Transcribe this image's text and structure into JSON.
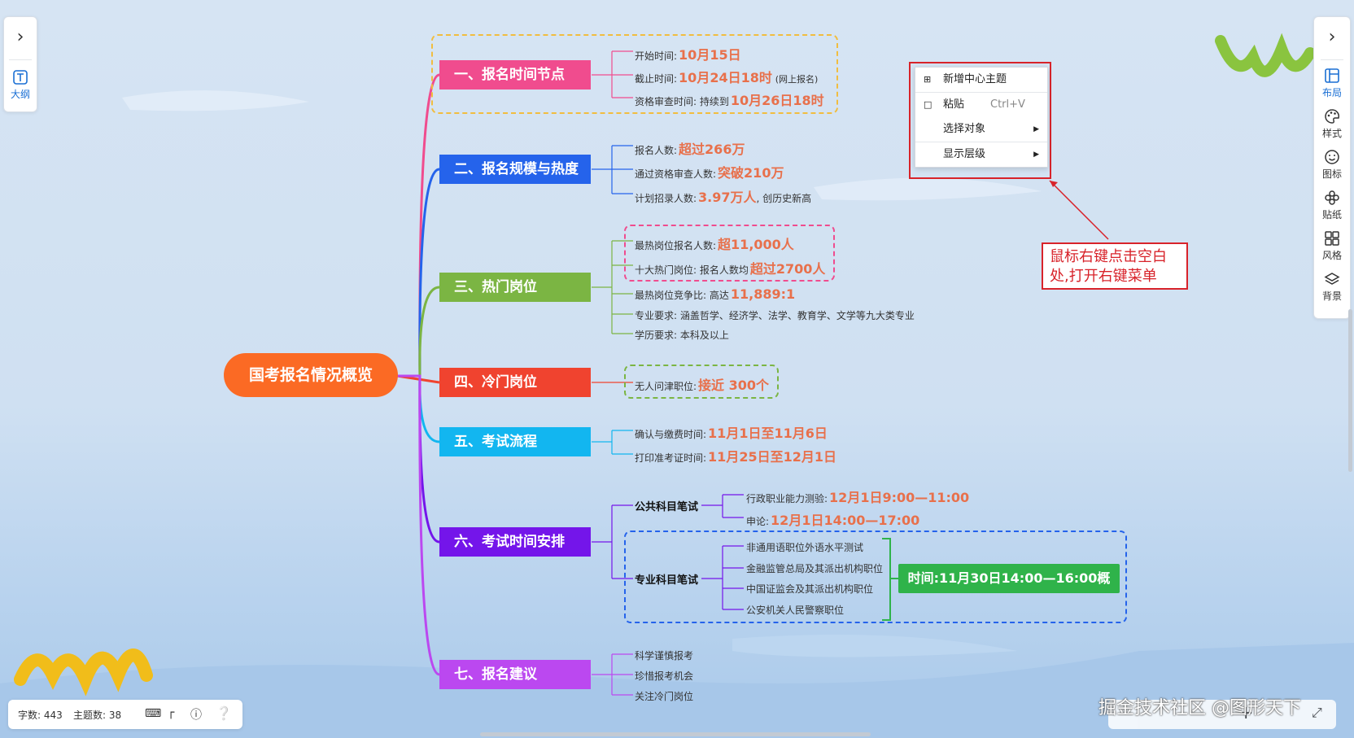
{
  "left_panel": {
    "expand_icon": "chevron-right-icon",
    "outline_label": "大纲"
  },
  "right_panel": {
    "tools": [
      {
        "icon": "layout-icon",
        "label": "布局",
        "active": true
      },
      {
        "icon": "palette-icon",
        "label": "样式",
        "active": false
      },
      {
        "icon": "emoji-icon",
        "label": "图标",
        "active": false
      },
      {
        "icon": "sticker-icon",
        "label": "贴纸",
        "active": false
      },
      {
        "icon": "grid-icon",
        "label": "风格",
        "active": false
      },
      {
        "icon": "layers-icon",
        "label": "背景",
        "active": false
      }
    ]
  },
  "mindmap": {
    "root": "国考报名情况概览",
    "branches": [
      {
        "label": "一、报名时间节点",
        "color": "#f04c8e"
      },
      {
        "label": "二、报名规模与热度",
        "color": "#2563eb"
      },
      {
        "label": "三、热门岗位",
        "color": "#7bb543"
      },
      {
        "label": "四、冷门岗位",
        "color": "#f0432f"
      },
      {
        "label": "五、考试流程",
        "color": "#12b6f0"
      },
      {
        "label": "六、考试时间安排",
        "color": "#7415ea"
      },
      {
        "label": "七、报名建议",
        "color": "#bb48f0"
      }
    ],
    "b1": {
      "l1": {
        "text": "开始时间:",
        "hi": "10月15日"
      },
      "l2": {
        "text": "截止时间:",
        "hi": "10月24日18时",
        "tail": "(网上报名)"
      },
      "l3": {
        "text": "资格审查时间:  持续到",
        "hi": "10月26日18时"
      }
    },
    "b2": {
      "l1": {
        "text": "报名人数:",
        "hi": "超过266万"
      },
      "l2": {
        "text": "通过资格审查人数:",
        "hi": "突破210万"
      },
      "l3": {
        "text": "计划招录人数:",
        "hi": "3.97万人",
        "tail": ", 创历史新高"
      }
    },
    "b3": {
      "l1": {
        "text": "最热岗位报名人数:",
        "hi": "超11,000人"
      },
      "l2": {
        "text": "十大热门岗位:  报名人数均",
        "hi": "超过2700人"
      },
      "l3": {
        "text": "最热岗位竞争比:  高达",
        "hi": "11,889:1"
      },
      "l4": {
        "text": "专业要求:  涵盖哲学、经济学、法学、教育学、文学等九大类专业"
      },
      "l5": {
        "text": "学历要求:  本科及以上"
      }
    },
    "b4": {
      "l1": {
        "text": "无人问津职位:",
        "hi": "接近 300个"
      }
    },
    "b5": {
      "l1": {
        "text": "确认与缴费时间:",
        "hi": "11月1日至11月6日"
      },
      "l2": {
        "text": "打印准考证时间:",
        "hi": "11月25日至12月1日"
      }
    },
    "b6": {
      "public": "公共科目笔试",
      "p1": {
        "text": "行政职业能力测验:",
        "hi": "12月1日9:00—11:00"
      },
      "p2": {
        "text": "申论:",
        "hi": "12月1日14:00—17:00"
      },
      "pro": "专业科目笔试",
      "pro_items": [
        "非通用语职位外语水平测试",
        "金融监管总局及其派出机构职位",
        "中国证监会及其派出机构职位",
        "公安机关人民警察职位"
      ],
      "pro_time": "时间:11月30日14:00—16:00概"
    },
    "b7": {
      "items": [
        "科学谨慎报考",
        "珍惜报考机会",
        "关注冷门岗位"
      ]
    }
  },
  "context_menu": {
    "items": [
      {
        "icon": "add-topic-icon",
        "label": "新增中心主题",
        "shortcut": "",
        "submenu": false
      },
      {
        "icon": "paste-icon",
        "label": "粘贴",
        "shortcut": "Ctrl+V",
        "submenu": false
      },
      {
        "icon": "",
        "label": "选择对象",
        "shortcut": "",
        "submenu": true
      },
      {
        "icon": "",
        "label": "显示层级",
        "shortcut": "",
        "submenu": true
      }
    ]
  },
  "annotation": {
    "text": "鼠标右键点击空白处,打开右键菜单",
    "line1": "鼠标右键点击空",
    "line2": "白",
    "text_l1": "鼠标右键点击空白",
    "text_l2": "处,打开右键菜单",
    "color": "#d8232a"
  },
  "status_bar": {
    "word_count": "字数: 443",
    "topic_count": "主题数: 38"
  },
  "watermark": "掘金技术社区 @图形天下"
}
